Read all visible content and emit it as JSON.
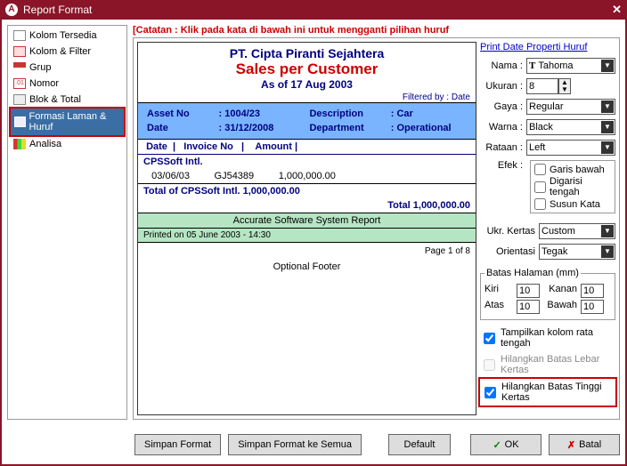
{
  "window": {
    "title": "Report Format"
  },
  "sidebar": {
    "items": [
      {
        "label": "Kolom Tersedia"
      },
      {
        "label": "Kolom & Filter"
      },
      {
        "label": "Grup"
      },
      {
        "label": "Nomor"
      },
      {
        "label": "Blok & Total"
      },
      {
        "label": "Formasi Laman & Huruf"
      },
      {
        "label": "Analisa"
      }
    ]
  },
  "warning": "[Catatan : Klik pada kata di bawah ini untuk mengganti pilihan huruf",
  "preview": {
    "company": "PT. Cipta Piranti Sejahtera",
    "title": "Sales per Customer",
    "asof": "As of 17 Aug 2003",
    "filtered": "Filtered by : Date",
    "asset_no_label": "Asset No",
    "asset_no": "1004/23",
    "desc_label": "Description",
    "desc": "Car",
    "date_label": "Date",
    "date": "31/12/2008",
    "dept_label": "Department",
    "dept": "Operational",
    "col_date": "Date",
    "col_inv": "Invoice No",
    "col_amt": "Amount",
    "group_name": "CPSSoft Intl.",
    "row_date": "03/06/03",
    "row_inv": "GJ54389",
    "row_amt": "1,000,000.00",
    "group_total_label": "Total of CPSSoft Intl.",
    "group_total_val": "1,000,000.00",
    "total_label": "Total",
    "total_val": "1,000,000.00",
    "system": "Accurate Software System Report",
    "printed": "Printed on 05 June 2003 - 14:30",
    "pageof": "Page 1 of 8",
    "optfooter": "Optional Footer"
  },
  "props": {
    "section_title": "Print Date Properti Huruf",
    "label_nama": "Nama :",
    "val_nama": "Tahoma",
    "label_ukuran": "Ukuran :",
    "val_ukuran": "8",
    "label_gaya": "Gaya :",
    "val_gaya": "Regular",
    "label_warna": "Warna :",
    "val_warna": "Black",
    "label_rataan": "Rataan :",
    "val_rataan": "Left",
    "label_efek": "Efek :",
    "efek_underline": "Garis bawah",
    "efek_strike": "Digarisi tengah",
    "efek_wrap": "Susun Kata",
    "label_paper": "Ukr. Kertas",
    "val_paper": "Custom",
    "label_orient": "Orientasi",
    "val_orient": "Tegak",
    "margin_legend": "Batas Halaman (mm)",
    "m_kiri_l": "Kiri",
    "m_kiri": "10",
    "m_kanan_l": "Kanan",
    "m_kanan": "10",
    "m_atas_l": "Atas",
    "m_atas": "10",
    "m_bawah_l": "Bawah",
    "m_bawah": "10",
    "cb_center": "Tampilkan kolom rata tengah",
    "cb_width": "Hilangkan Batas Lebar Kertas",
    "cb_height": "Hilangkan Batas Tinggi Kertas"
  },
  "buttons": {
    "save": "Simpan Format",
    "save_all": "Simpan Format ke Semua",
    "default": "Default",
    "ok": "OK",
    "cancel": "Batal"
  }
}
